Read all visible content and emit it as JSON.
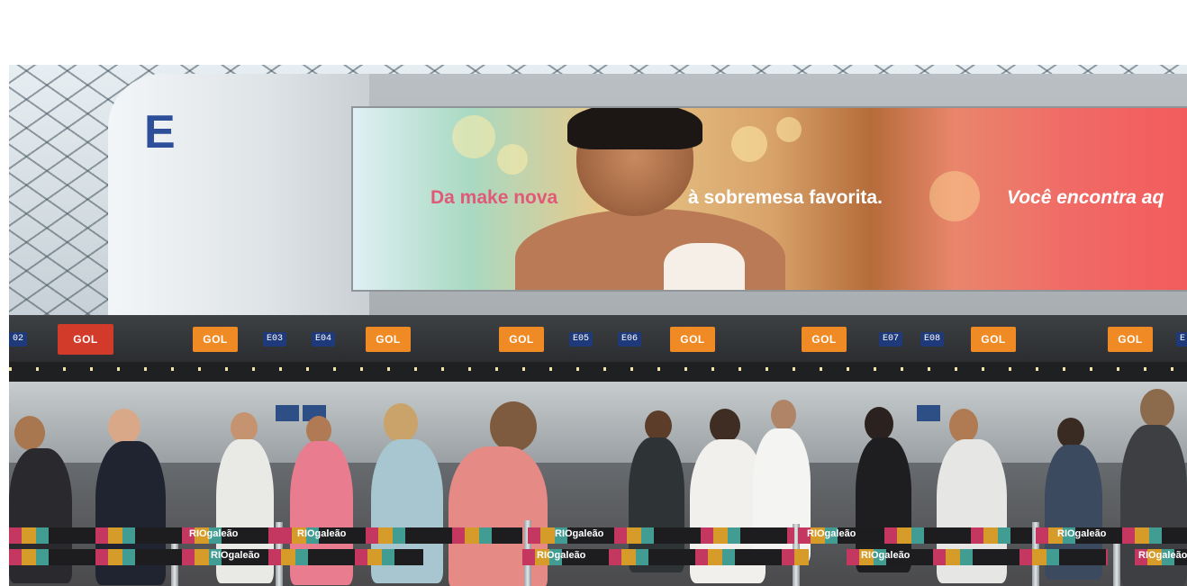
{
  "billboard": {
    "text_1": "Da make nova",
    "text_2": "à sobremesa favorita.",
    "text_3": "Você encontra aq"
  },
  "pillar": {
    "letter": "E"
  },
  "counters": {
    "airline_logo": "GOL",
    "numbers": [
      "02",
      "E03",
      "E04",
      "E05",
      "E06",
      "E07",
      "E08",
      "E"
    ]
  },
  "belts": {
    "brand": "RIOgaleão"
  },
  "colors": {
    "airline_orange": "#f08a24",
    "airline_red": "#d23a2a",
    "counter_blue": "#1f3a7a",
    "ad_pink": "#e05a78"
  }
}
